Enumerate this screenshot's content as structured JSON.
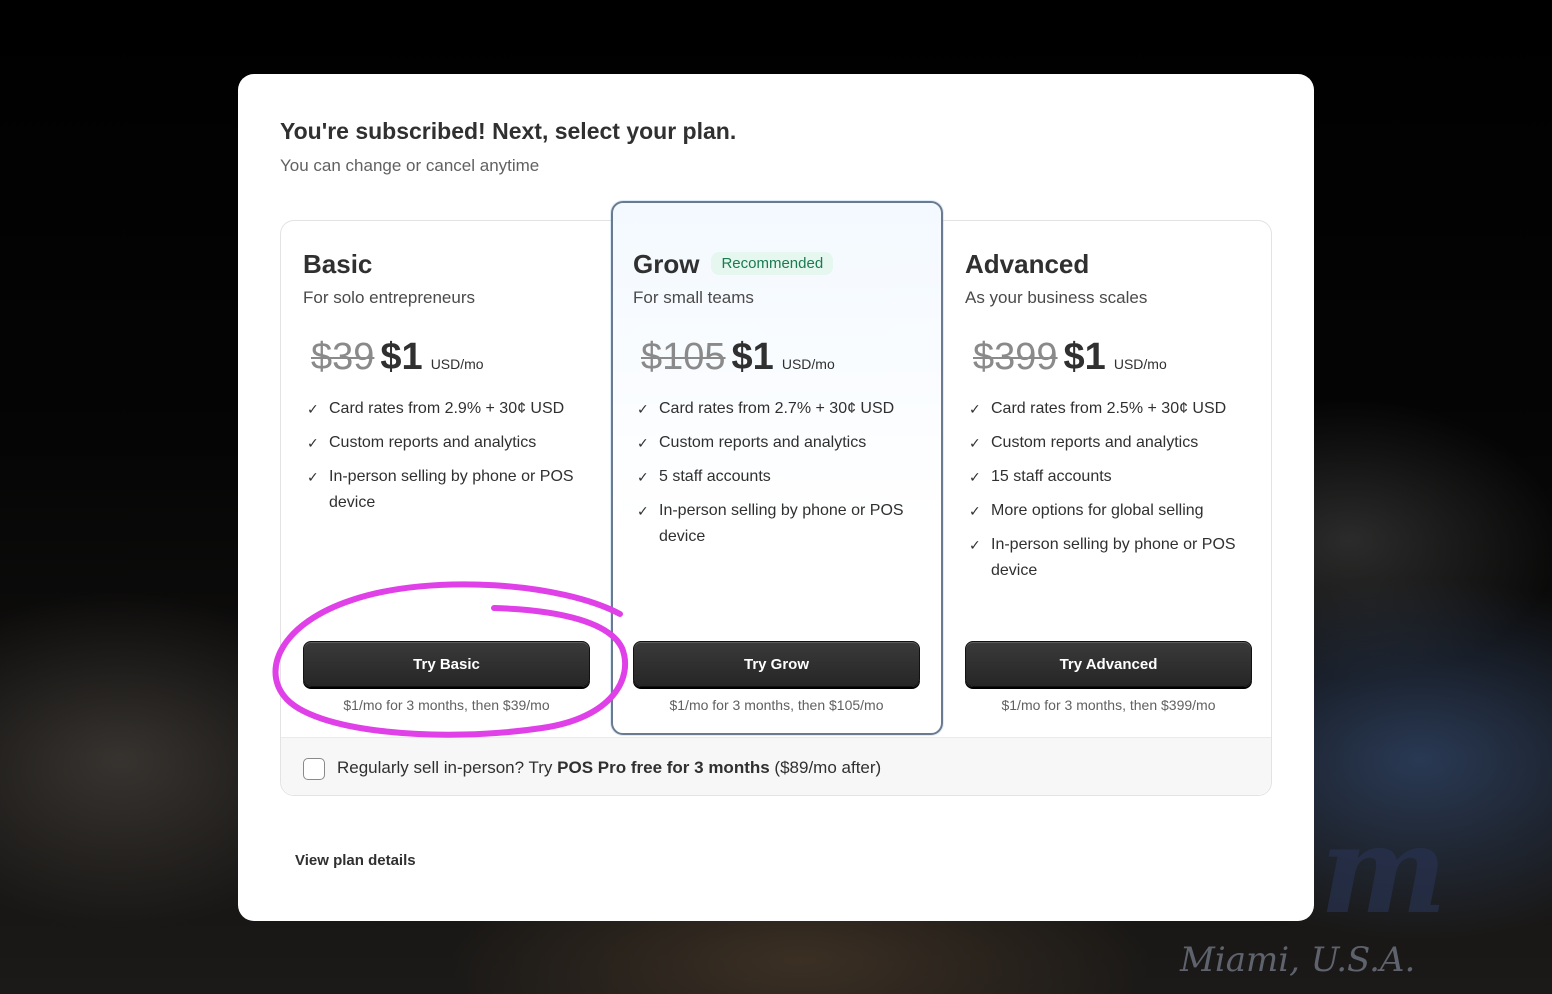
{
  "background": {
    "script_text": "Miami, U.S.A."
  },
  "modal": {
    "title": "You're subscribed! Next, select your plan.",
    "subtitle": "You can change or cancel anytime",
    "view_details_label": "View plan details"
  },
  "plans": [
    {
      "name": "Basic",
      "tagline": "For solo entrepreneurs",
      "old_price": "$39",
      "new_price": "$1",
      "unit": "USD/mo",
      "features": [
        "Card rates from 2.9% + 30¢ USD",
        "Custom reports and analytics",
        "In-person selling by phone or POS device"
      ],
      "button_label": "Try Basic",
      "button_note": "$1/mo for 3 months, then $39/mo"
    },
    {
      "name": "Grow",
      "badge": "Recommended",
      "tagline": "For small teams",
      "old_price": "$105",
      "new_price": "$1",
      "unit": "USD/mo",
      "features": [
        "Card rates from 2.7% + 30¢ USD",
        "Custom reports and analytics",
        "5 staff accounts",
        "In-person selling by phone or POS device"
      ],
      "button_label": "Try Grow",
      "button_note": "$1/mo for 3 months, then $105/mo"
    },
    {
      "name": "Advanced",
      "tagline": "As your business scales",
      "old_price": "$399",
      "new_price": "$1",
      "unit": "USD/mo",
      "features": [
        "Card rates from 2.5% + 30¢ USD",
        "Custom reports and analytics",
        "15 staff accounts",
        "More options for global selling",
        "In-person selling by phone or POS device"
      ],
      "button_label": "Try Advanced",
      "button_note": "$1/mo for 3 months, then $399/mo"
    }
  ],
  "pos_offer": {
    "checked": false,
    "prefix": "Regularly sell in-person? Try ",
    "bold": "POS Pro free for 3 months",
    "suffix": " ($89/mo after)"
  },
  "colors": {
    "annotation": "#e040e8",
    "badge_bg": "#e6f7ef",
    "badge_text": "#1b7a52",
    "button_bg": "#2f2f2f"
  },
  "icons": {
    "feature_check": "✓"
  }
}
